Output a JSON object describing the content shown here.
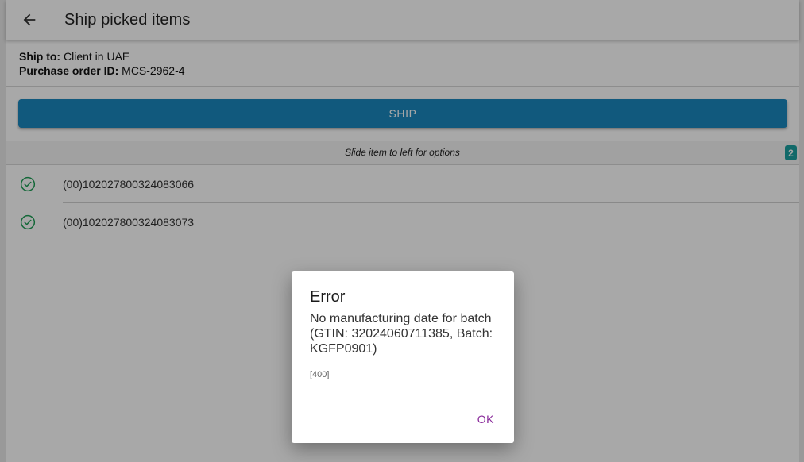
{
  "toolbar": {
    "back_icon": "arrow-left-icon",
    "title": "Ship picked items"
  },
  "info": {
    "ship_to_label": "Ship to:",
    "ship_to_value": "Client in UAE",
    "po_label": "Purchase order ID:",
    "po_value": "MCS-2962-4"
  },
  "ship_button": {
    "label": "SHIP",
    "color": "#1b88be"
  },
  "hint": {
    "text": "Slide item to left for options",
    "count": "2",
    "count_color": "#1aa0a0"
  },
  "items": [
    {
      "status_icon": "check-circle-icon",
      "code": "(00)102027800324083066"
    },
    {
      "status_icon": "check-circle-icon",
      "code": "(00)102027800324083073"
    }
  ],
  "dialog": {
    "title": "Error",
    "message": "No manufacturing date for batch (GTIN: 32024060711385, Batch: KGFP0901)",
    "code": "[400]",
    "ok_label": "OK",
    "ok_color": "#8a2c9b"
  }
}
